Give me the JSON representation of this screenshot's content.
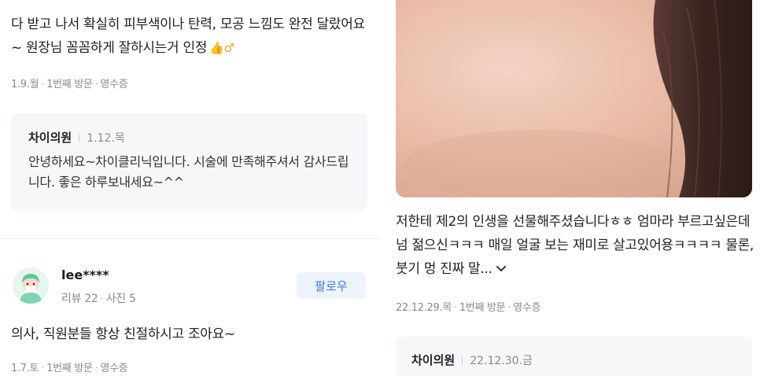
{
  "left": {
    "review1": {
      "text": "다 받고 나서 확실히 피부색이나 탄력, 모공 느낌도 완전 달랐어요~ 원장님 꼼꼼하게 잘하시는거 인정",
      "emoji": "👍♂",
      "date": "1.9.월",
      "visit": "1번째 방문",
      "receipt": "영수증",
      "reply": {
        "author": "차이의원",
        "date": "1.12.목",
        "text": "안녕하세요~차이클리닉입니다. 시술에 만족해주셔서 감사드립니다. 좋은 하루보내세요~^^"
      }
    },
    "review2": {
      "username": "lee****",
      "reviews": "리뷰 22",
      "photos": "사진 5",
      "follow_label": "팔로우",
      "text": "의사, 직원분들 항상 친절하시고 조아요~",
      "date": "1.7.토",
      "visit": "1번째 방문",
      "receipt": "영수증"
    }
  },
  "right": {
    "review": {
      "text": "저한테 제2의 인생을 선물해주셨습니다ㅎㅎ 엄마라 부르고싶은데 넘 젊으신ㅋㅋㅋ 매일 얼굴 보는 재미로 살고있어용ㅋㅋㅋㅋ 물론, 붓기 멍 진짜 말...",
      "date": "22.12.29.목",
      "visit": "1번째 방문",
      "receipt": "영수증",
      "reply": {
        "author": "차이의원",
        "date": "22.12.30.금"
      }
    }
  },
  "icons": {
    "avatar": "avatar-icon",
    "expand": "chevron-down-icon"
  },
  "colors": {
    "follow_text": "#3a7bd5",
    "follow_bg": "#eef4fc",
    "reply_bg": "#f5f7f9"
  }
}
